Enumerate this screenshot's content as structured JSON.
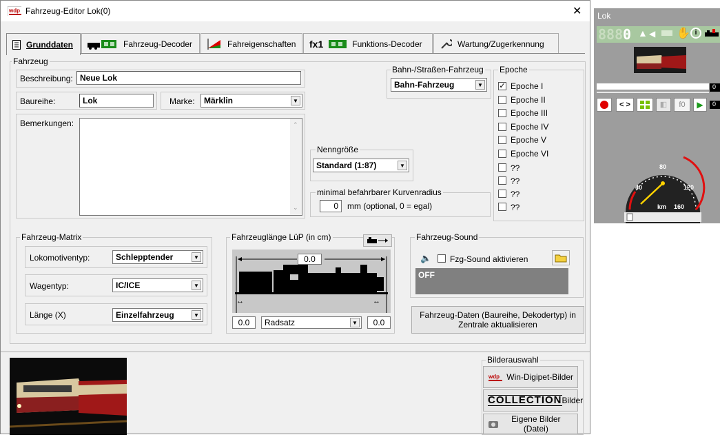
{
  "window": {
    "title": "Fahrzeug-Editor Lok(0)",
    "close": "✕"
  },
  "tabs": [
    {
      "label": "Grunddaten",
      "icon": "list-icon"
    },
    {
      "label": "Fahrzeug-Decoder",
      "icon": "decoder-icon"
    },
    {
      "label": "Fahreigenschaften",
      "icon": "speed-curve-icon"
    },
    {
      "label": "Funktions-Decoder",
      "icon": "fx-decoder-icon",
      "prefix": "fx1"
    },
    {
      "label": "Wartung/Zugerkennung",
      "icon": "wrench-icon"
    }
  ],
  "fahrzeug": {
    "legend": "Fahrzeug",
    "beschreibung_label": "Beschreibung:",
    "beschreibung_value": "Neue Lok",
    "baureihe_label": "Baureihe:",
    "baureihe_value": "Lok",
    "marke_label": "Marke:",
    "marke_value": "Märklin",
    "bemerkungen_label": "Bemerkungen:"
  },
  "bahn": {
    "legend": "Bahn-/Straßen-Fahrzeug",
    "value": "Bahn-Fahrzeug"
  },
  "nenngroesse": {
    "legend": "Nenngröße",
    "value": "Standard (1:87)"
  },
  "kurvenradius": {
    "legend": "minimal befahrbarer Kurvenradius",
    "value": "0",
    "hint": "mm (optional, 0 = egal)"
  },
  "epoche": {
    "legend": "Epoche",
    "items": [
      {
        "label": "Epoche I",
        "checked": "✓"
      },
      {
        "label": "Epoche II",
        "checked": ""
      },
      {
        "label": "Epoche III",
        "checked": ""
      },
      {
        "label": "Epoche IV",
        "checked": ""
      },
      {
        "label": "Epoche V",
        "checked": ""
      },
      {
        "label": "Epoche VI",
        "checked": ""
      },
      {
        "label": "??",
        "checked": ""
      },
      {
        "label": "??",
        "checked": ""
      },
      {
        "label": "??",
        "checked": ""
      },
      {
        "label": "??",
        "checked": ""
      }
    ]
  },
  "matrix": {
    "legend": "Fahrzeug-Matrix",
    "lokotyp_label": "Lokomotiventyp:",
    "lokotyp_value": "Schlepptender",
    "wagentyp_label": "Wagentyp:",
    "wagentyp_value": "IC/ICE",
    "laenge_label": "Länge (X)",
    "laenge_value": "Einzelfahrzeug"
  },
  "laenge": {
    "legend": "Fahrzeuglänge LüP (in cm)",
    "total": "0.0",
    "left": "0.0",
    "right": "0.0",
    "achse": "Radsatz"
  },
  "sound": {
    "legend": "Fahrzeug-Sound",
    "checkbox_label": "Fzg-Sound aktivieren",
    "display": "OFF"
  },
  "update_button": "Fahrzeug-Daten (Baureihe, Dekodertyp) in Zentrale aktualisieren",
  "bilder": {
    "legend": "Bilderauswahl",
    "win_button": "Win-Digipet-Bilder",
    "collection_logo": "COLLECTION",
    "collection_button": "Bilder",
    "eigene_button": "Eigene Bilder (Datei)"
  },
  "lok": {
    "title": "Lok",
    "address": "0",
    "speed_display": "0",
    "gauge_labels": [
      "40",
      "80",
      "120",
      "km",
      "160"
    ],
    "extra": "0",
    "f0": "f0"
  },
  "colors": {
    "accent": "#008000",
    "panel": "#9d9d9d",
    "soundbox": "#808080"
  }
}
